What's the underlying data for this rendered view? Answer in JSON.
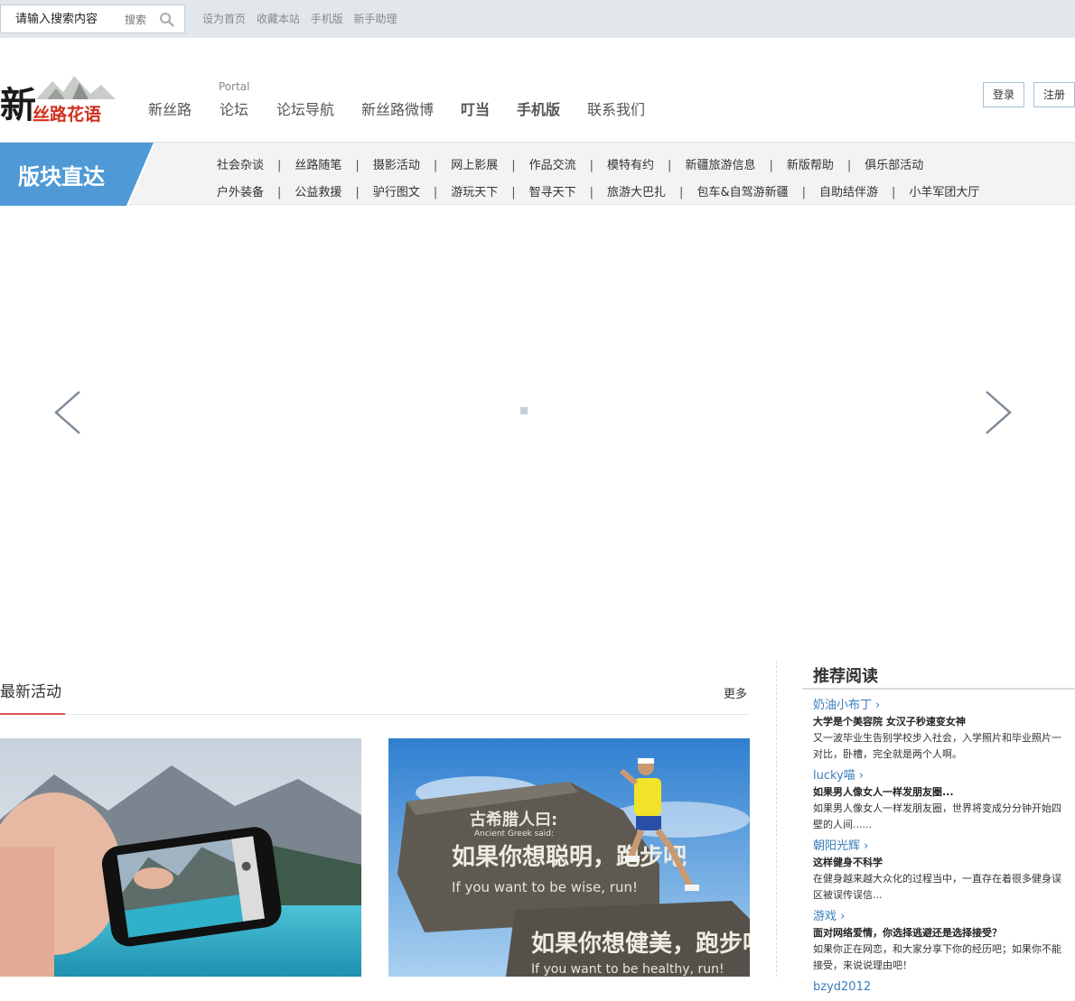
{
  "topbar": {
    "search_placeholder": "请输入搜索内容",
    "search_button": "搜索",
    "links": [
      "设为首页",
      "收藏本站",
      "手机版",
      "新手助理"
    ]
  },
  "header": {
    "logo_text": "新丝路花语",
    "portal_label": "Portal",
    "nav": [
      "新丝路",
      "论坛",
      "论坛导航",
      "新丝路微博",
      "叮当",
      "手机版",
      "联系我们"
    ],
    "login": "登录",
    "register": "注册"
  },
  "sections": {
    "label": "版块直达",
    "row1": [
      "社会杂谈",
      "丝路随笔",
      "摄影活动",
      "网上影展",
      "作品交流",
      "模特有约",
      "新疆旅游信息",
      "新版帮助",
      "俱乐部活动"
    ],
    "row2": [
      "户外装备",
      "公益救援",
      "驴行图文",
      "游玩天下",
      "智寻天下",
      "旅游大巴扎",
      "包车&自驾游新疆",
      "自助结伴游",
      "小羊军团大厅"
    ]
  },
  "activities": {
    "title": "最新活动",
    "more": "更多",
    "poster_texts": [
      "古希腊人曰:",
      "Ancient Greek said:",
      "如果你想聪明，跑步吧",
      "If you want to be wise, run!",
      "如果你想健美，跑步吧",
      "If you want to be healthy, run!"
    ]
  },
  "recommend": {
    "title": "推荐阅读",
    "items": [
      {
        "user": "奶油小布丁 ›",
        "headline": "大学是个美容院 女汉子秒速变女神",
        "desc": "又一波毕业生告别学校步入社会，入学照片和毕业照片一对比，卧槽，完全就是两个人啊。"
      },
      {
        "user": "lucky喵 ›",
        "headline": "如果男人像女人一样发朋友圈...",
        "desc": "如果男人像女人一样发朋友圈，世界将变成分分钟开始四壁的人间......"
      },
      {
        "user": "朝阳光辉 ›",
        "headline": "这样健身不科学",
        "desc": "在健身越来越大众化的过程当中，一直存在着很多健身误区被误传误信..."
      },
      {
        "user": "游戏 ›",
        "headline": "面对网络爱情，你选择逃避还是选择接受？",
        "desc": "如果你正在网恋，和大家分享下你的经历吧；如果你不能接受，来说说理由吧！"
      },
      {
        "user": "bzyd2012",
        "headline": "",
        "desc": ""
      }
    ]
  }
}
